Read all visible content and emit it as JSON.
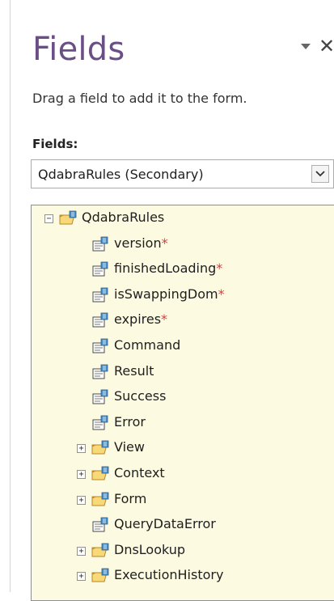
{
  "pane": {
    "title": "Fields",
    "menu_icon": "dropdown-triangle-icon",
    "close_glyph": "✕",
    "instruction": "Drag a field to add it to the form.",
    "fields_label": "Fields:",
    "data_source": "QdabraRules (Secondary)",
    "dropdown_icon": "chevron-down-icon"
  },
  "colors": {
    "title": "#6a4f86",
    "tree_background": "#fcfbe2",
    "required_marker": "#e0393e",
    "folder": "#e8b63a"
  },
  "tree": {
    "root": {
      "name": "QdabraRules",
      "expander": "⊟",
      "icon": "group-folder-icon"
    },
    "items": [
      {
        "name": "version",
        "required": "*",
        "icon": "attribute-field-icon"
      },
      {
        "name": "finishedLoading",
        "required": "*",
        "icon": "attribute-field-icon"
      },
      {
        "name": "isSwappingDom",
        "required": "*",
        "icon": "attribute-field-icon"
      },
      {
        "name": "expires",
        "required": "*",
        "icon": "attribute-field-icon"
      },
      {
        "name": "Command",
        "icon": "element-field-icon"
      },
      {
        "name": "Result",
        "icon": "element-field-icon"
      },
      {
        "name": "Success",
        "icon": "element-field-icon"
      },
      {
        "name": "Error",
        "icon": "element-field-icon"
      },
      {
        "name": "View",
        "expander": "+",
        "icon": "group-folder-icon"
      },
      {
        "name": "Context",
        "expander": "+",
        "icon": "group-folder-icon"
      },
      {
        "name": "Form",
        "expander": "+",
        "icon": "group-folder-icon"
      },
      {
        "name": "QueryDataError",
        "icon": "element-field-icon"
      },
      {
        "name": "DnsLookup",
        "expander": "+",
        "icon": "group-folder-icon"
      },
      {
        "name": "ExecutionHistory",
        "expander": "+",
        "icon": "group-folder-icon"
      }
    ]
  }
}
